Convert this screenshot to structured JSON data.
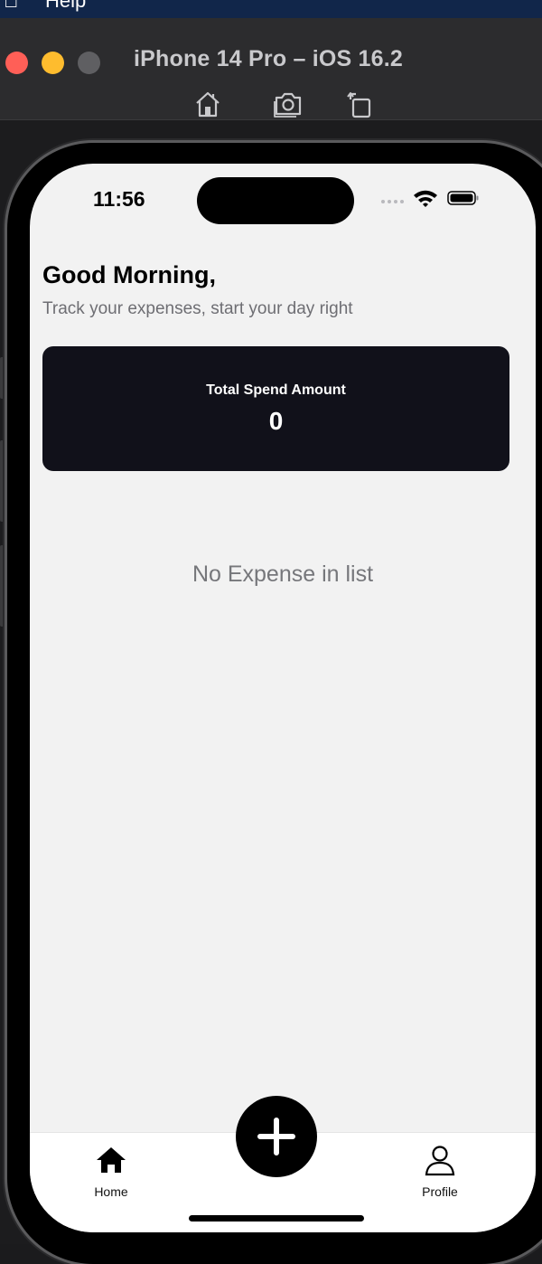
{
  "menubar": {
    "items": [
      "",
      "Help"
    ]
  },
  "window": {
    "title": "iPhone 14 Pro – iOS 16.2",
    "toolbar": [
      {
        "icon": "home-icon"
      },
      {
        "icon": "screenshot-icon"
      },
      {
        "icon": "rotate-icon"
      }
    ]
  },
  "status_bar": {
    "time": "11:56",
    "icons": [
      "signal-dots-icon",
      "wifi-icon",
      "battery-icon"
    ]
  },
  "header": {
    "greeting": "Good Morning,",
    "subtitle": "Track your expenses, start your day right"
  },
  "summary_card": {
    "label": "Total Spend Amount",
    "value": "0"
  },
  "expense_list": {
    "empty_message": "No Expense in list"
  },
  "tab_bar": {
    "tabs": [
      {
        "label": "Home",
        "icon": "home-icon"
      },
      {
        "label": "Profile",
        "icon": "user-icon"
      }
    ],
    "fab_icon": "plus-icon"
  }
}
